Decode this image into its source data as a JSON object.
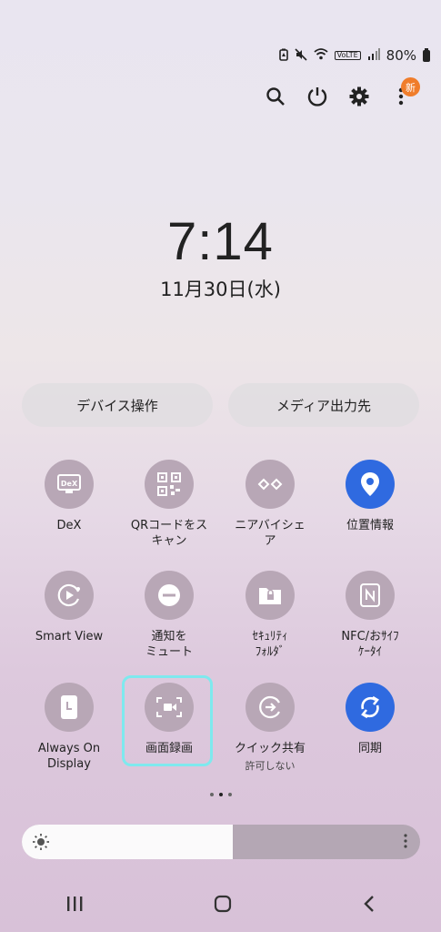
{
  "status": {
    "signal_label": "VoLTE",
    "battery": "80%"
  },
  "topbar": {
    "new_badge": "新"
  },
  "clock": {
    "time": "7:14",
    "date": "11月30日(水)"
  },
  "pills": {
    "devices": "デバイス操作",
    "media": "メディア出力先"
  },
  "tiles": [
    {
      "label": "DeX",
      "icon": "dex-icon",
      "active": false
    },
    {
      "label": "QRコードをス\nキャン",
      "icon": "qr-code-icon",
      "active": false
    },
    {
      "label": "ニアバイシェ\nア",
      "icon": "nearby-share-icon",
      "active": false
    },
    {
      "label": "位置情報",
      "icon": "location-pin-icon",
      "active": true
    },
    {
      "label": "Smart View",
      "icon": "smart-view-icon",
      "active": false
    },
    {
      "label": "通知を\nミュート",
      "icon": "mute-notifications-icon",
      "active": false
    },
    {
      "label": "ｾｷｭﾘﾃｨ\nﾌｫﾙﾀﾞ",
      "icon": "secure-folder-icon",
      "active": false
    },
    {
      "label": "NFC/おｻｲﾌ\nｹｰﾀｲ",
      "icon": "nfc-icon",
      "active": false
    },
    {
      "label": "Always On\nDisplay",
      "icon": "always-on-display-icon",
      "active": false
    },
    {
      "label": "画面録画",
      "icon": "screen-recorder-icon",
      "active": false
    },
    {
      "label": "クイック共有",
      "sub": "許可しない",
      "icon": "quick-share-icon",
      "active": false
    },
    {
      "label": "同期",
      "icon": "sync-icon",
      "active": true
    }
  ],
  "pager": {
    "pages": 3,
    "current": 2
  },
  "brightness": {
    "level": 0.53
  },
  "colors": {
    "accent": "#2f6ae0",
    "tile_off": "#b8a7b6",
    "highlight": "#7ee9ee",
    "badge": "#f07d2b"
  }
}
